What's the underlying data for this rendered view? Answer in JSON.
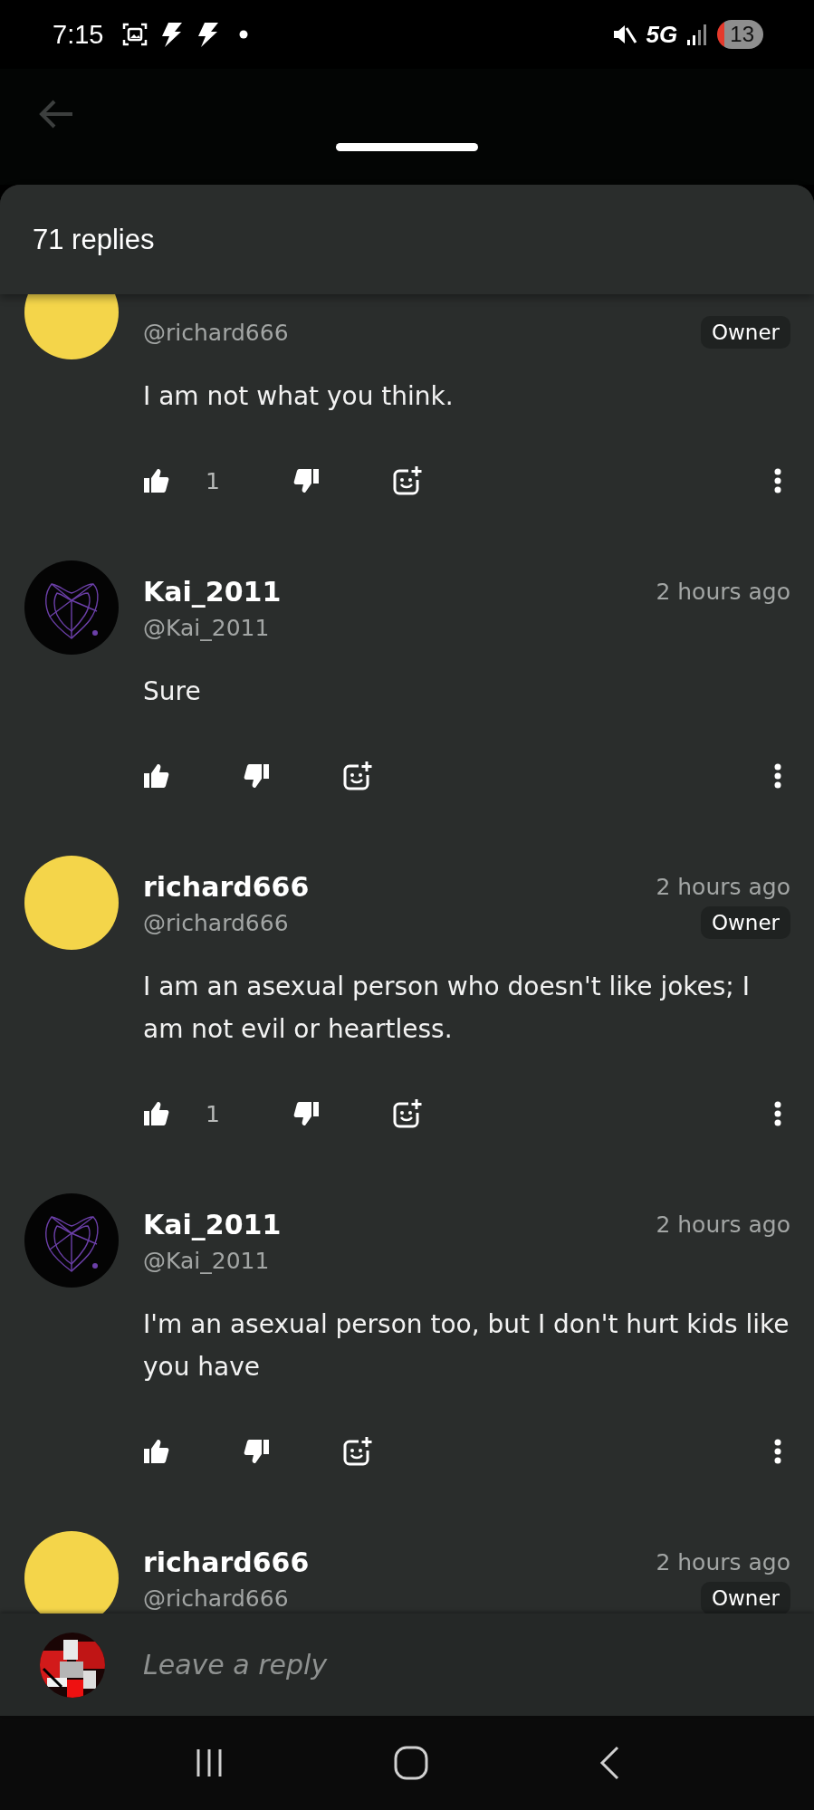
{
  "status_bar": {
    "time": "7:15",
    "network": "5G",
    "battery": "13"
  },
  "sheet": {
    "title": "71 replies"
  },
  "comments": [
    {
      "handle": "@richard666",
      "badge": "Owner",
      "body": "I am not what you think.",
      "likes": "1",
      "avatar": {
        "color": "#f4d54a"
      }
    },
    {
      "name": "Kai_2011",
      "time": "2 hours ago",
      "handle": "@Kai_2011",
      "body": "Sure"
    },
    {
      "name": "richard666",
      "time": "2 hours ago",
      "handle": "@richard666",
      "badge": "Owner",
      "body": "I am an asexual person who doesn't like jokes; I am not evil or heartless.",
      "likes": "1",
      "avatar": {
        "color": "#f4d54a"
      }
    },
    {
      "name": "Kai_2011",
      "time": "2 hours ago",
      "handle": "@Kai_2011",
      "body": "I'm an asexual person too, but I don't hurt kids like you have"
    },
    {
      "name": "richard666",
      "time": "2 hours ago",
      "handle": "@richard666",
      "badge": "Owner",
      "avatar": {
        "color": "#f4d54a"
      }
    }
  ],
  "reply_bar": {
    "placeholder": "Leave a reply"
  }
}
